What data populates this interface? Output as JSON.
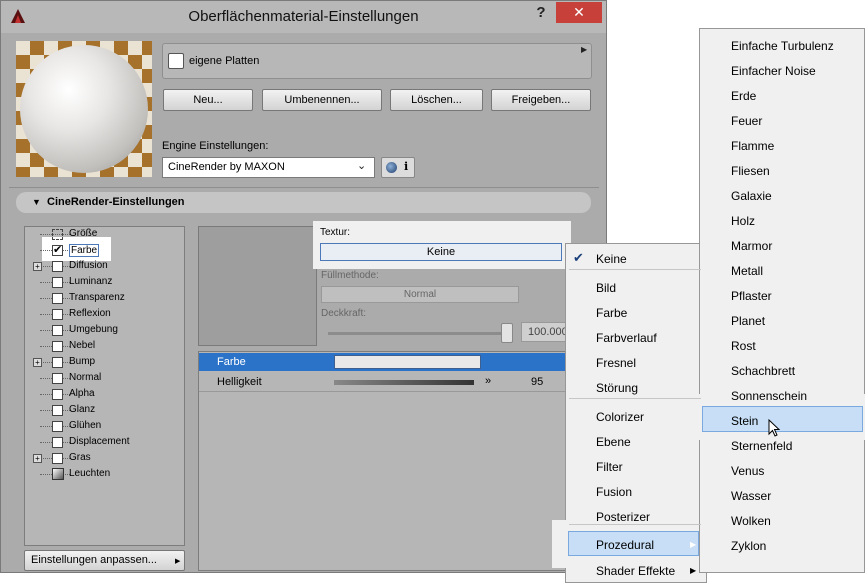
{
  "window": {
    "title": "Oberflächenmaterial-Einstellungen",
    "help_label": "?",
    "close_label": "✕"
  },
  "material": {
    "platten_label": "eigene Platten",
    "buttons": {
      "neu": "Neu...",
      "umbenennen": "Umbenennen...",
      "loeschen": "Löschen...",
      "freigeben": "Freigeben..."
    },
    "engine_label": "Engine Einstellungen:",
    "engine_value": "CineRender by MAXON",
    "engine_info": "i"
  },
  "cinerender": {
    "header": "CineRender-Einstellungen",
    "tree": [
      {
        "label": "Größe",
        "checked": false,
        "expandable": false
      },
      {
        "label": "Farbe",
        "checked": true,
        "expandable": false
      },
      {
        "label": "Diffusion",
        "checked": false,
        "expandable": true
      },
      {
        "label": "Luminanz",
        "checked": false,
        "expandable": false
      },
      {
        "label": "Transparenz",
        "checked": false,
        "expandable": false
      },
      {
        "label": "Reflexion",
        "checked": false,
        "expandable": false
      },
      {
        "label": "Umgebung",
        "checked": false,
        "expandable": false
      },
      {
        "label": "Nebel",
        "checked": false,
        "expandable": false
      },
      {
        "label": "Bump",
        "checked": false,
        "expandable": true
      },
      {
        "label": "Normal",
        "checked": false,
        "expandable": false
      },
      {
        "label": "Alpha",
        "checked": false,
        "expandable": false
      },
      {
        "label": "Glanz",
        "checked": false,
        "expandable": false
      },
      {
        "label": "Glühen",
        "checked": false,
        "expandable": false
      },
      {
        "label": "Displacement",
        "checked": false,
        "expandable": false
      },
      {
        "label": "Gras",
        "checked": false,
        "expandable": true
      },
      {
        "label": "Leuchten",
        "checked": false,
        "expandable": false
      }
    ],
    "settings_button": "Einstellungen anpassen...",
    "textur_label": "Textur:",
    "textur_value": "Keine",
    "fuell_label": "Füllmethode:",
    "fuell_value": "Normal",
    "deck_label": "Deckkraft:",
    "deck_value": "100.000",
    "props": [
      {
        "label": "Farbe"
      },
      {
        "label": "Helligkeit",
        "value": "95"
      }
    ]
  },
  "menu_main": {
    "items": [
      {
        "label": "Keine",
        "checked": true
      },
      {
        "label": "Bild"
      },
      {
        "label": "Farbe"
      },
      {
        "label": "Farbverlauf"
      },
      {
        "label": "Fresnel"
      },
      {
        "label": "Störung"
      },
      {
        "label": "Colorizer"
      },
      {
        "label": "Ebene"
      },
      {
        "label": "Filter"
      },
      {
        "label": "Fusion"
      },
      {
        "label": "Posterizer"
      },
      {
        "label": "Prozedural",
        "highlighted": true
      },
      {
        "label": "Shader Effekte"
      }
    ]
  },
  "menu_prozedural": {
    "items": [
      {
        "label": "Einfache Turbulenz"
      },
      {
        "label": "Einfacher Noise"
      },
      {
        "label": "Erde"
      },
      {
        "label": "Feuer"
      },
      {
        "label": "Flamme"
      },
      {
        "label": "Fliesen"
      },
      {
        "label": "Galaxie"
      },
      {
        "label": "Holz"
      },
      {
        "label": "Marmor"
      },
      {
        "label": "Metall"
      },
      {
        "label": "Pflaster"
      },
      {
        "label": "Planet"
      },
      {
        "label": "Rost"
      },
      {
        "label": "Schachbrett"
      },
      {
        "label": "Sonnenschein"
      },
      {
        "label": "Stein",
        "highlighted": true
      },
      {
        "label": "Sternenfeld"
      },
      {
        "label": "Venus"
      },
      {
        "label": "Wasser"
      },
      {
        "label": "Wolken"
      },
      {
        "label": "Zyklon"
      }
    ]
  },
  "colors": {
    "selection": "#2b73c8",
    "menu_highlight": "#c7def6",
    "close_button": "#c7403a"
  }
}
